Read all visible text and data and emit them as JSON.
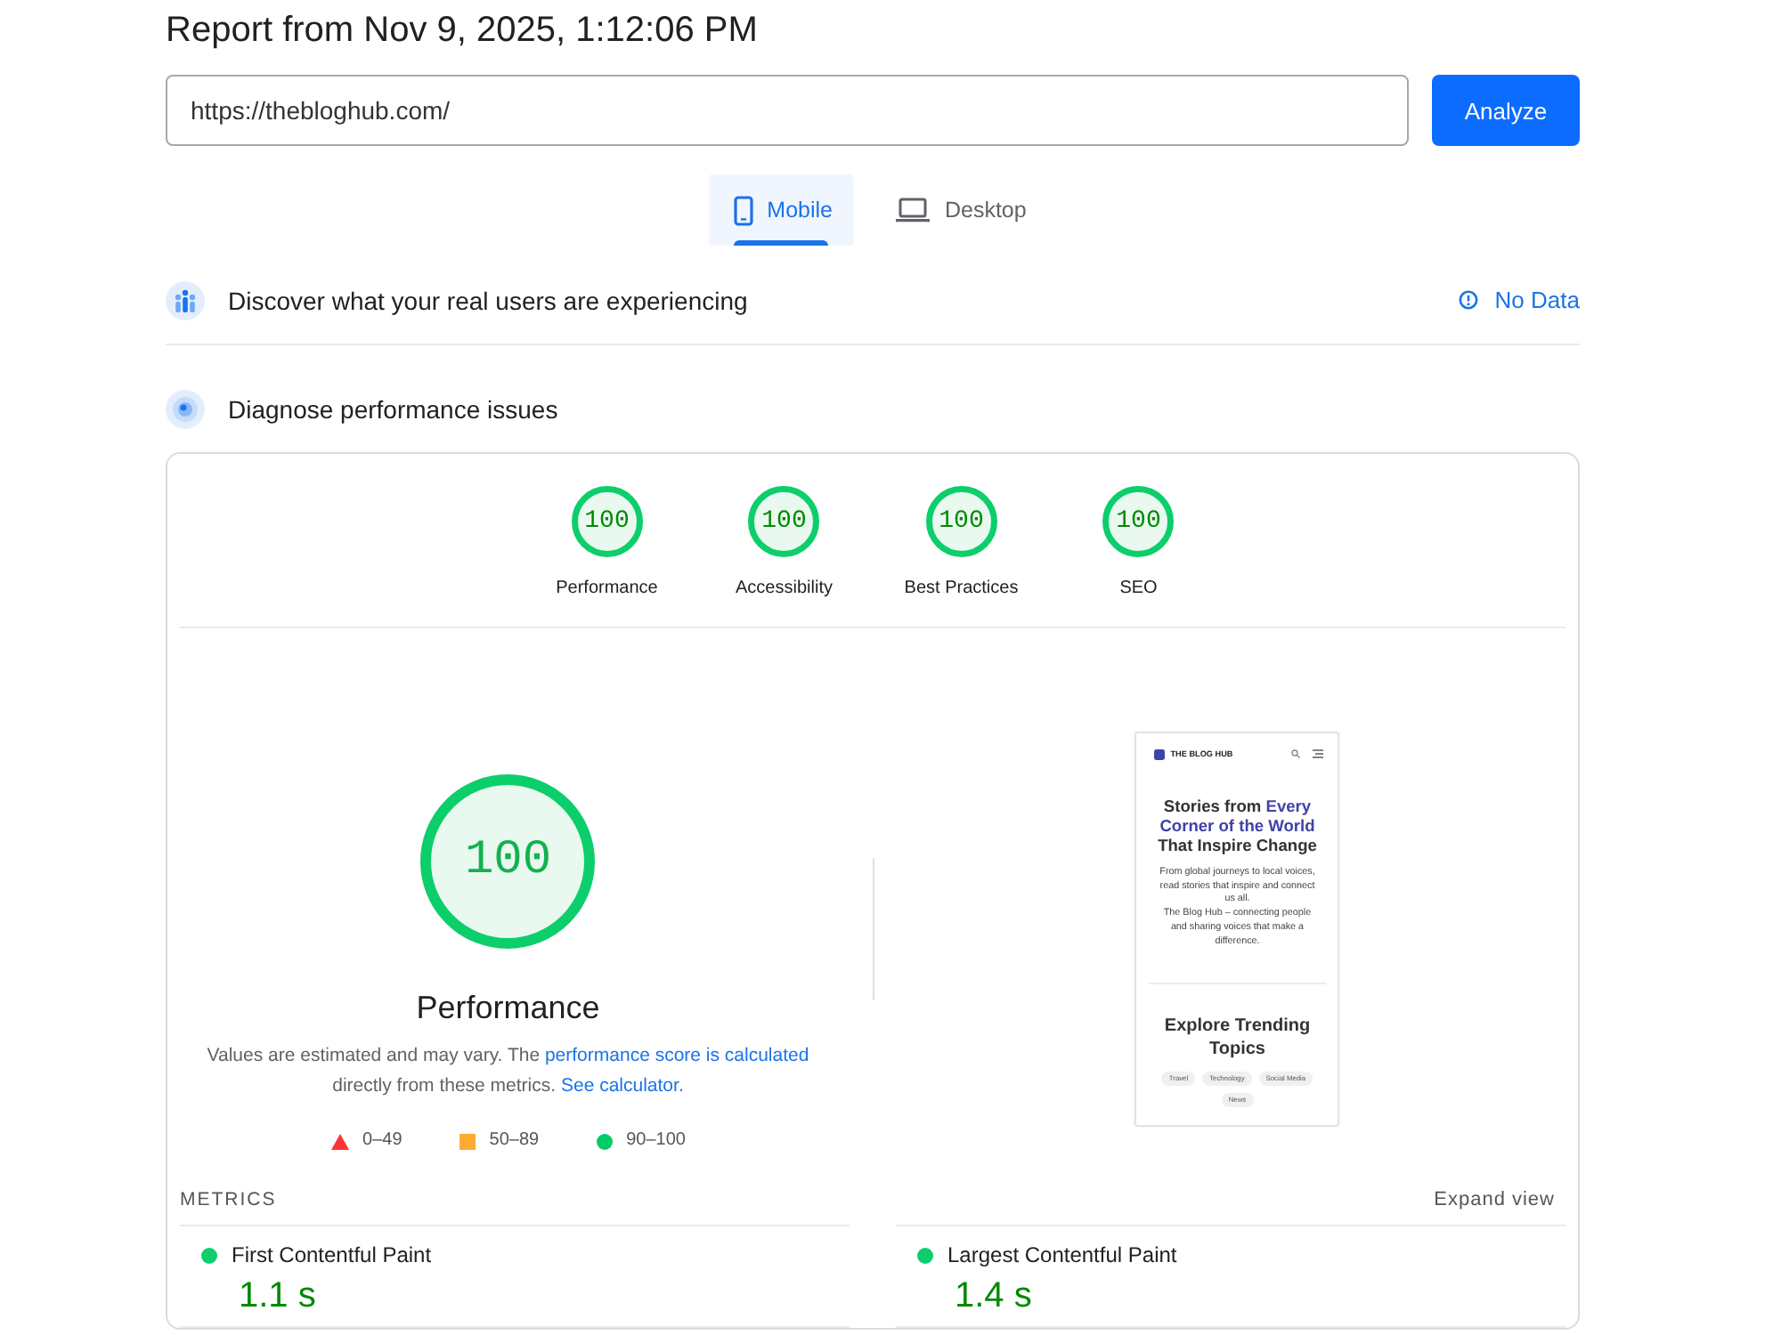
{
  "report_title": "Report from Nov 9, 2025, 1:12:06 PM",
  "url_field": {
    "value": "https://thebloghub.com/"
  },
  "analyze_button": {
    "label": "Analyze"
  },
  "tabs": [
    {
      "label": "Mobile",
      "kind": "mobile",
      "selected": true
    },
    {
      "label": "Desktop",
      "kind": "desktop",
      "selected": false
    }
  ],
  "field_data": {
    "title": "Discover what your real users are experiencing",
    "status": "No Data"
  },
  "lab_data": {
    "title": "Diagnose performance issues",
    "categories": [
      {
        "score": "100",
        "label": "Performance",
        "kind": "pass",
        "level": 1
      },
      {
        "score": "100",
        "label": "Accessibility",
        "kind": "pass",
        "level": 1
      },
      {
        "score": "100",
        "label": "Best Practices",
        "kind": "pass",
        "level": 1
      },
      {
        "score": "100",
        "label": "SEO",
        "kind": "pass",
        "level": 1
      }
    ],
    "performance": {
      "score": "100",
      "label": "Performance",
      "kind": "pass",
      "level": 1,
      "note": [
        {
          "kind": "text",
          "text": "Values are estimated and may vary. The "
        },
        {
          "kind": "link",
          "text": "performance score is calculated"
        },
        {
          "kind": "text",
          "text": " directly from these metrics. "
        },
        {
          "kind": "link",
          "text": "See calculator."
        }
      ],
      "legend": [
        {
          "kind": "fail",
          "range": "0–49"
        },
        {
          "kind": "average",
          "range": "50–89"
        },
        {
          "kind": "pass",
          "range": "90–100"
        }
      ]
    },
    "screenshot": {
      "brand": "THE BLOG HUB",
      "heading": [
        {
          "text": "Stories from ",
          "accent": false
        },
        {
          "text": "Every Corner of the World",
          "accent": true
        },
        {
          "text": " That Inspire Change",
          "accent": false
        }
      ],
      "paragraphs": [
        "From global journeys to local voices, read stories that inspire and connect us all.",
        "The Blog Hub – connecting people and sharing voices that make a difference."
      ],
      "topics_heading": "Explore Trending Topics",
      "topics": [
        "Travel",
        "Technology",
        "Social Media",
        "News"
      ]
    },
    "metrics": {
      "title": "METRICS",
      "expand_label": "Expand view",
      "items": [
        {
          "label": "First Contentful Paint",
          "value": "1.1 s",
          "kind": "pass"
        },
        {
          "label": "Largest Contentful Paint",
          "value": "1.4 s",
          "kind": "pass"
        }
      ]
    }
  }
}
